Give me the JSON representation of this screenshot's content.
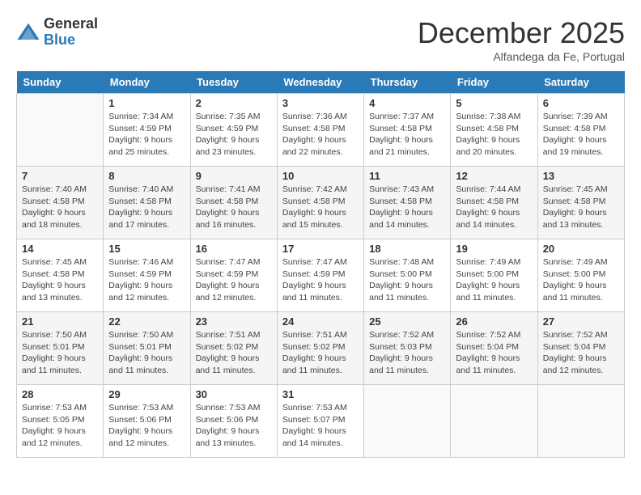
{
  "header": {
    "logo_general": "General",
    "logo_blue": "Blue",
    "month_title": "December 2025",
    "location": "Alfandega da Fe, Portugal"
  },
  "weekdays": [
    "Sunday",
    "Monday",
    "Tuesday",
    "Wednesday",
    "Thursday",
    "Friday",
    "Saturday"
  ],
  "weeks": [
    [
      {
        "day": "",
        "sunrise": "",
        "sunset": "",
        "daylight": ""
      },
      {
        "day": "1",
        "sunrise": "Sunrise: 7:34 AM",
        "sunset": "Sunset: 4:59 PM",
        "daylight": "Daylight: 9 hours and 25 minutes."
      },
      {
        "day": "2",
        "sunrise": "Sunrise: 7:35 AM",
        "sunset": "Sunset: 4:59 PM",
        "daylight": "Daylight: 9 hours and 23 minutes."
      },
      {
        "day": "3",
        "sunrise": "Sunrise: 7:36 AM",
        "sunset": "Sunset: 4:58 PM",
        "daylight": "Daylight: 9 hours and 22 minutes."
      },
      {
        "day": "4",
        "sunrise": "Sunrise: 7:37 AM",
        "sunset": "Sunset: 4:58 PM",
        "daylight": "Daylight: 9 hours and 21 minutes."
      },
      {
        "day": "5",
        "sunrise": "Sunrise: 7:38 AM",
        "sunset": "Sunset: 4:58 PM",
        "daylight": "Daylight: 9 hours and 20 minutes."
      },
      {
        "day": "6",
        "sunrise": "Sunrise: 7:39 AM",
        "sunset": "Sunset: 4:58 PM",
        "daylight": "Daylight: 9 hours and 19 minutes."
      }
    ],
    [
      {
        "day": "7",
        "sunrise": "Sunrise: 7:40 AM",
        "sunset": "Sunset: 4:58 PM",
        "daylight": "Daylight: 9 hours and 18 minutes."
      },
      {
        "day": "8",
        "sunrise": "Sunrise: 7:40 AM",
        "sunset": "Sunset: 4:58 PM",
        "daylight": "Daylight: 9 hours and 17 minutes."
      },
      {
        "day": "9",
        "sunrise": "Sunrise: 7:41 AM",
        "sunset": "Sunset: 4:58 PM",
        "daylight": "Daylight: 9 hours and 16 minutes."
      },
      {
        "day": "10",
        "sunrise": "Sunrise: 7:42 AM",
        "sunset": "Sunset: 4:58 PM",
        "daylight": "Daylight: 9 hours and 15 minutes."
      },
      {
        "day": "11",
        "sunrise": "Sunrise: 7:43 AM",
        "sunset": "Sunset: 4:58 PM",
        "daylight": "Daylight: 9 hours and 14 minutes."
      },
      {
        "day": "12",
        "sunrise": "Sunrise: 7:44 AM",
        "sunset": "Sunset: 4:58 PM",
        "daylight": "Daylight: 9 hours and 14 minutes."
      },
      {
        "day": "13",
        "sunrise": "Sunrise: 7:45 AM",
        "sunset": "Sunset: 4:58 PM",
        "daylight": "Daylight: 9 hours and 13 minutes."
      }
    ],
    [
      {
        "day": "14",
        "sunrise": "Sunrise: 7:45 AM",
        "sunset": "Sunset: 4:58 PM",
        "daylight": "Daylight: 9 hours and 13 minutes."
      },
      {
        "day": "15",
        "sunrise": "Sunrise: 7:46 AM",
        "sunset": "Sunset: 4:59 PM",
        "daylight": "Daylight: 9 hours and 12 minutes."
      },
      {
        "day": "16",
        "sunrise": "Sunrise: 7:47 AM",
        "sunset": "Sunset: 4:59 PM",
        "daylight": "Daylight: 9 hours and 12 minutes."
      },
      {
        "day": "17",
        "sunrise": "Sunrise: 7:47 AM",
        "sunset": "Sunset: 4:59 PM",
        "daylight": "Daylight: 9 hours and 11 minutes."
      },
      {
        "day": "18",
        "sunrise": "Sunrise: 7:48 AM",
        "sunset": "Sunset: 5:00 PM",
        "daylight": "Daylight: 9 hours and 11 minutes."
      },
      {
        "day": "19",
        "sunrise": "Sunrise: 7:49 AM",
        "sunset": "Sunset: 5:00 PM",
        "daylight": "Daylight: 9 hours and 11 minutes."
      },
      {
        "day": "20",
        "sunrise": "Sunrise: 7:49 AM",
        "sunset": "Sunset: 5:00 PM",
        "daylight": "Daylight: 9 hours and 11 minutes."
      }
    ],
    [
      {
        "day": "21",
        "sunrise": "Sunrise: 7:50 AM",
        "sunset": "Sunset: 5:01 PM",
        "daylight": "Daylight: 9 hours and 11 minutes."
      },
      {
        "day": "22",
        "sunrise": "Sunrise: 7:50 AM",
        "sunset": "Sunset: 5:01 PM",
        "daylight": "Daylight: 9 hours and 11 minutes."
      },
      {
        "day": "23",
        "sunrise": "Sunrise: 7:51 AM",
        "sunset": "Sunset: 5:02 PM",
        "daylight": "Daylight: 9 hours and 11 minutes."
      },
      {
        "day": "24",
        "sunrise": "Sunrise: 7:51 AM",
        "sunset": "Sunset: 5:02 PM",
        "daylight": "Daylight: 9 hours and 11 minutes."
      },
      {
        "day": "25",
        "sunrise": "Sunrise: 7:52 AM",
        "sunset": "Sunset: 5:03 PM",
        "daylight": "Daylight: 9 hours and 11 minutes."
      },
      {
        "day": "26",
        "sunrise": "Sunrise: 7:52 AM",
        "sunset": "Sunset: 5:04 PM",
        "daylight": "Daylight: 9 hours and 11 minutes."
      },
      {
        "day": "27",
        "sunrise": "Sunrise: 7:52 AM",
        "sunset": "Sunset: 5:04 PM",
        "daylight": "Daylight: 9 hours and 12 minutes."
      }
    ],
    [
      {
        "day": "28",
        "sunrise": "Sunrise: 7:53 AM",
        "sunset": "Sunset: 5:05 PM",
        "daylight": "Daylight: 9 hours and 12 minutes."
      },
      {
        "day": "29",
        "sunrise": "Sunrise: 7:53 AM",
        "sunset": "Sunset: 5:06 PM",
        "daylight": "Daylight: 9 hours and 12 minutes."
      },
      {
        "day": "30",
        "sunrise": "Sunrise: 7:53 AM",
        "sunset": "Sunset: 5:06 PM",
        "daylight": "Daylight: 9 hours and 13 minutes."
      },
      {
        "day": "31",
        "sunrise": "Sunrise: 7:53 AM",
        "sunset": "Sunset: 5:07 PM",
        "daylight": "Daylight: 9 hours and 14 minutes."
      },
      {
        "day": "",
        "sunrise": "",
        "sunset": "",
        "daylight": ""
      },
      {
        "day": "",
        "sunrise": "",
        "sunset": "",
        "daylight": ""
      },
      {
        "day": "",
        "sunrise": "",
        "sunset": "",
        "daylight": ""
      }
    ]
  ]
}
